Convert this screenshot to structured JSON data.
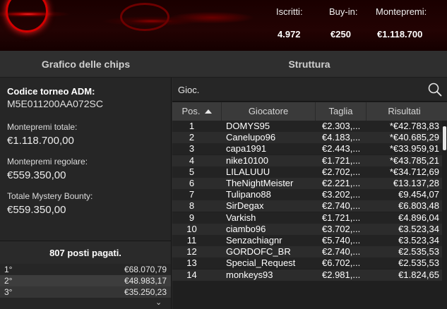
{
  "header": {
    "stats": [
      {
        "label": "Iscritti:",
        "value": "4.972"
      },
      {
        "label": "Buy-in:",
        "value": "€250"
      },
      {
        "label": "Montepremi:",
        "value": "€1.118.700"
      }
    ]
  },
  "tabs": [
    {
      "label": "Grafico delle chips"
    },
    {
      "label": "Struttura"
    }
  ],
  "info": {
    "code_label": "Codice torneo ADM:",
    "code_value": "M5E011200AA072SC",
    "prize_total_label": "Montepremi totale:",
    "prize_total_value": "€1.118.700,00",
    "prize_regular_label": "Montepremi regolare:",
    "prize_regular_value": "€559.350,00",
    "mystery_label": "Totale Mystery Bounty:",
    "mystery_value": "€559.350,00",
    "paid_places": "807 posti pagati."
  },
  "payouts": [
    {
      "place": "1°",
      "amount": "€68.070,79"
    },
    {
      "place": "2°",
      "amount": "€48.983,17"
    },
    {
      "place": "3°",
      "amount": "€35.250,23"
    }
  ],
  "search": {
    "placeholder": "Gioc."
  },
  "table": {
    "headers": {
      "pos": "Pos.",
      "player": "Giocatore",
      "stack": "Taglia",
      "result": "Risultati"
    },
    "rows": [
      {
        "pos": "1",
        "player": "DOMYS95",
        "stack": "€2.303,...",
        "result": "*€42.783,83"
      },
      {
        "pos": "2",
        "player": "Canelupo96",
        "stack": "€4.183,...",
        "result": "*€40.685,29"
      },
      {
        "pos": "3",
        "player": "capa1991",
        "stack": "€2.443,...",
        "result": "*€33.959,91"
      },
      {
        "pos": "4",
        "player": "nike10100",
        "stack": "€1.721,...",
        "result": "*€43.785,21"
      },
      {
        "pos": "5",
        "player": "LILALUUU",
        "stack": "€2.702,...",
        "result": "*€34.712,69"
      },
      {
        "pos": "6",
        "player": "TheNightMeister",
        "stack": "€2.221,...",
        "result": "€13.137,28"
      },
      {
        "pos": "7",
        "player": "Tulipano88",
        "stack": "€3.202,...",
        "result": "€9.454,07"
      },
      {
        "pos": "8",
        "player": "SirDegax",
        "stack": "€2.740,...",
        "result": "€6.803,48"
      },
      {
        "pos": "9",
        "player": "Varkish",
        "stack": "€1.721,...",
        "result": "€4.896,04"
      },
      {
        "pos": "10",
        "player": "ciambo96",
        "stack": "€3.702,...",
        "result": "€3.523,34"
      },
      {
        "pos": "11",
        "player": "Senzachiagnr",
        "stack": "€5.740,...",
        "result": "€3.523,34"
      },
      {
        "pos": "12",
        "player": "GORDOFC_BR",
        "stack": "€2.740,...",
        "result": "€2.535,53"
      },
      {
        "pos": "13",
        "player": "Special_Request",
        "stack": "€6.702,...",
        "result": "€2.535,53"
      },
      {
        "pos": "14",
        "player": "monkeys93",
        "stack": "€2.981,...",
        "result": "€1.824,65"
      }
    ]
  }
}
